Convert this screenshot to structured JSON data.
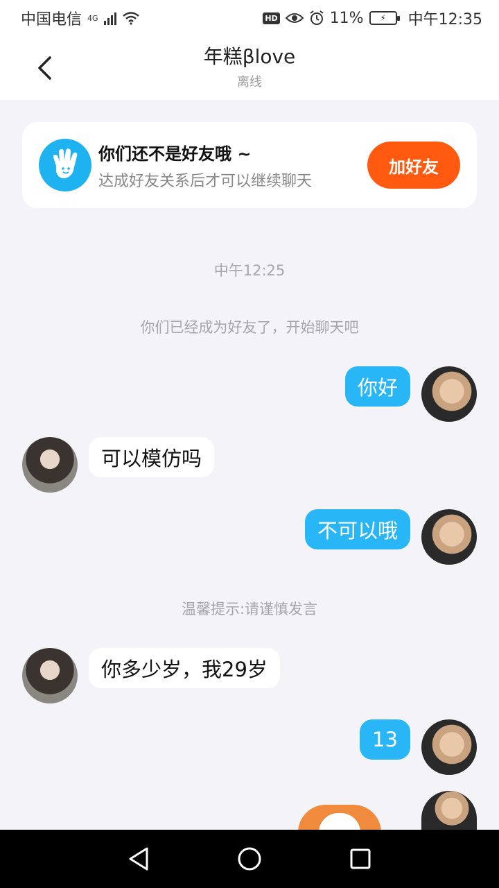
{
  "status_bar": {
    "carrier": "中国电信",
    "network": "4G",
    "battery": "11%",
    "time": "中午12:35",
    "hd_badge": "HD"
  },
  "header": {
    "title": "年糕βlove",
    "status": "离线"
  },
  "friend_card": {
    "title": "你们还不是好友哦 ~",
    "description": "达成好友关系后才可以继续聊天",
    "button_label": "加好友"
  },
  "chat": {
    "timestamp": "中午12:25",
    "system_notice": "你们已经成为好友了，开始聊天吧",
    "messages": [
      {
        "sender": "me",
        "text": "你好"
      },
      {
        "sender": "other",
        "text": "可以模仿吗"
      },
      {
        "sender": "me",
        "text": "不可以哦"
      },
      {
        "sender": "other",
        "text": "你多少岁，我29岁"
      },
      {
        "sender": "me",
        "text": "13"
      }
    ],
    "tip": "温馨提示:请谨慎发言"
  },
  "colors": {
    "accent_blue": "#29b6f6",
    "add_button": "#ff5a0f",
    "background": "#f4f3f8"
  }
}
